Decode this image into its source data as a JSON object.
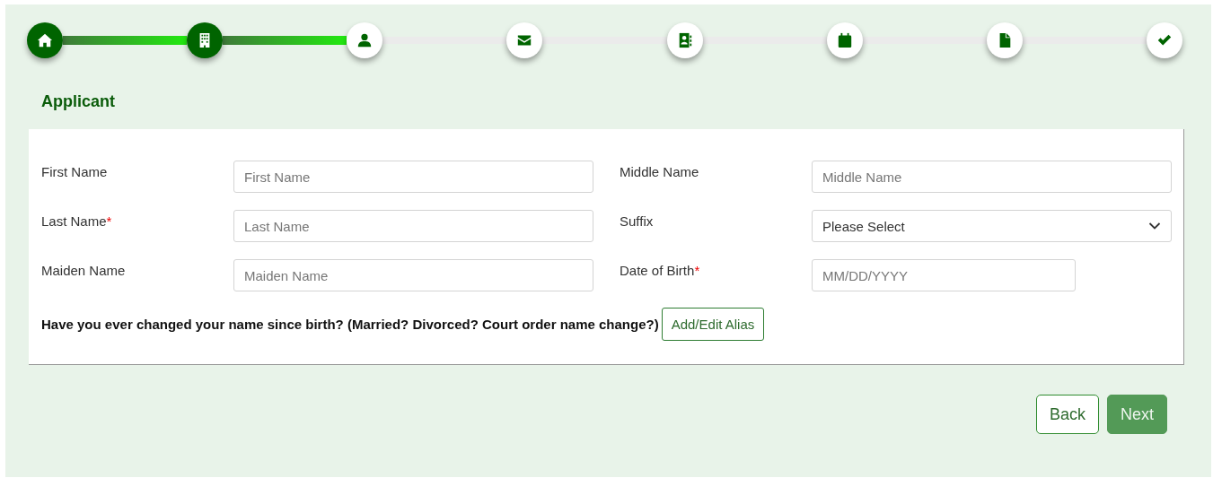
{
  "steps": [
    {
      "kind": "home",
      "completed": true
    },
    {
      "kind": "building",
      "completed": true
    },
    {
      "kind": "user",
      "completed": false
    },
    {
      "kind": "envelope",
      "completed": false
    },
    {
      "kind": "address-book",
      "completed": false
    },
    {
      "kind": "calendar",
      "completed": false
    },
    {
      "kind": "file",
      "completed": false
    },
    {
      "kind": "check",
      "completed": false
    }
  ],
  "section_title": "Applicant",
  "fields": [
    {
      "label": "First Name",
      "kind": "text",
      "placeholder": "First Name"
    },
    {
      "label": "Middle Name",
      "kind": "text",
      "placeholder": "Middle Name"
    },
    {
      "label": "Last Name",
      "required_mark": "*",
      "kind": "text",
      "placeholder": "Last Name"
    },
    {
      "label": "Suffix",
      "kind": "select",
      "value": "Please Select"
    },
    {
      "label": "Maiden Name",
      "kind": "text",
      "placeholder": "Maiden Name"
    },
    {
      "label": "Date of Birth",
      "required_mark": "*",
      "kind": "date",
      "placeholder": "MM/DD/YYYY"
    }
  ],
  "alias_question": "Have you ever changed your name since birth? (Married? Divorced? Court order name change?)",
  "alias_button": "Add/Edit Alias",
  "buttons": [
    {
      "label": "Back",
      "kind": "secondary"
    },
    {
      "label": "Next",
      "kind": "primary"
    }
  ]
}
